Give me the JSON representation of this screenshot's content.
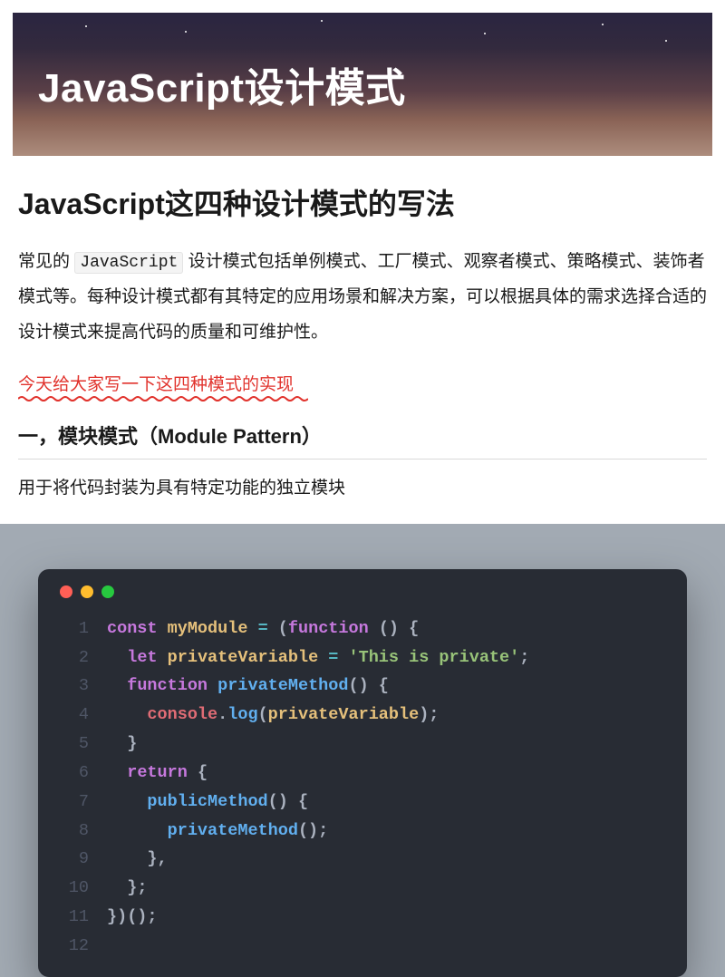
{
  "hero": {
    "title": "JavaScript设计模式"
  },
  "article": {
    "title": "JavaScript这四种设计模式的写法",
    "intro_pre": "常见的 ",
    "intro_code": "JavaScript",
    "intro_post": " 设计模式包括单例模式、工厂模式、观察者模式、策略模式、装饰者模式等。每种设计模式都有其特定的应用场景和解决方案，可以根据具体的需求选择合适的设计模式来提高代码的质量和可维护性。",
    "highlight": "今天给大家写一下这四种模式的实现",
    "section1": {
      "heading": "一，模块模式（Module Pattern）",
      "desc": "用于将代码封装为具有特定功能的独立模块"
    }
  },
  "code": {
    "lines": [
      [
        {
          "t": "kw",
          "v": "const"
        },
        {
          "t": "p",
          "v": " "
        },
        {
          "t": "var",
          "v": "myModule"
        },
        {
          "t": "p",
          "v": " "
        },
        {
          "t": "op",
          "v": "="
        },
        {
          "t": "p",
          "v": " "
        },
        {
          "t": "pun",
          "v": "("
        },
        {
          "t": "kw",
          "v": "function"
        },
        {
          "t": "p",
          "v": " "
        },
        {
          "t": "pun",
          "v": "() {"
        }
      ],
      [
        {
          "t": "p",
          "v": "  "
        },
        {
          "t": "kw",
          "v": "let"
        },
        {
          "t": "p",
          "v": " "
        },
        {
          "t": "var",
          "v": "privateVariable"
        },
        {
          "t": "p",
          "v": " "
        },
        {
          "t": "op",
          "v": "="
        },
        {
          "t": "p",
          "v": " "
        },
        {
          "t": "str",
          "v": "'This is private'"
        },
        {
          "t": "pun",
          "v": ";"
        }
      ],
      [
        {
          "t": "p",
          "v": "  "
        },
        {
          "t": "kw",
          "v": "function"
        },
        {
          "t": "p",
          "v": " "
        },
        {
          "t": "fn",
          "v": "privateMethod"
        },
        {
          "t": "pun",
          "v": "() {"
        }
      ],
      [
        {
          "t": "p",
          "v": "    "
        },
        {
          "t": "obj",
          "v": "console"
        },
        {
          "t": "pun",
          "v": "."
        },
        {
          "t": "fn",
          "v": "log"
        },
        {
          "t": "pun",
          "v": "("
        },
        {
          "t": "var",
          "v": "privateVariable"
        },
        {
          "t": "pun",
          "v": ");"
        }
      ],
      [
        {
          "t": "p",
          "v": "  "
        },
        {
          "t": "pun",
          "v": "}"
        }
      ],
      [
        {
          "t": "p",
          "v": "  "
        },
        {
          "t": "kw",
          "v": "return"
        },
        {
          "t": "p",
          "v": " "
        },
        {
          "t": "pun",
          "v": "{"
        }
      ],
      [
        {
          "t": "p",
          "v": "    "
        },
        {
          "t": "fn",
          "v": "publicMethod"
        },
        {
          "t": "pun",
          "v": "() {"
        }
      ],
      [
        {
          "t": "p",
          "v": "      "
        },
        {
          "t": "fn",
          "v": "privateMethod"
        },
        {
          "t": "pun",
          "v": "();"
        }
      ],
      [
        {
          "t": "p",
          "v": "    "
        },
        {
          "t": "pun",
          "v": "},"
        }
      ],
      [
        {
          "t": "p",
          "v": "  "
        },
        {
          "t": "pun",
          "v": "};"
        }
      ],
      [
        {
          "t": "pun",
          "v": "})();"
        }
      ],
      [
        {
          "t": "p",
          "v": ""
        }
      ]
    ]
  }
}
